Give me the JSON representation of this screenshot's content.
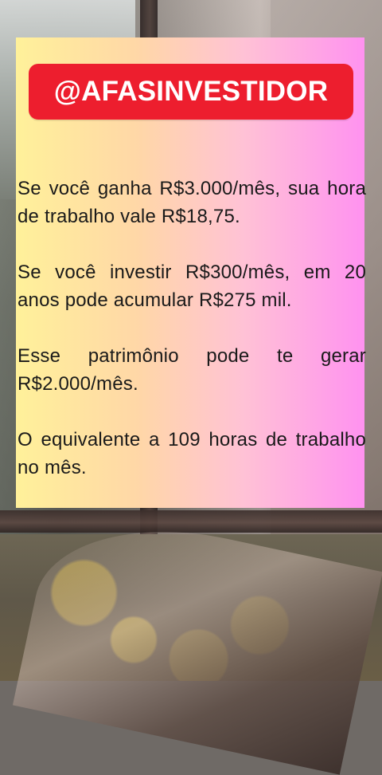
{
  "card": {
    "handle": "@AFASINVESTIDOR",
    "paragraphs": [
      "Se você ganha R$3.000/mês, sua hora de trabalho vale R$18,75.",
      "Se você investir R$300/mês, em 20 anos pode acumular R$275 mil.",
      "Esse patrimônio pode te gerar R$2.000/mês.",
      "O equivalente a 109 horas de trabalho no mês."
    ]
  },
  "colors": {
    "handle_bg": "#ed1e2e",
    "handle_text": "#ffffff",
    "card_gradient_left": "#fff19a",
    "card_gradient_right": "#ff92f0",
    "body_text": "#1a1a1a"
  }
}
